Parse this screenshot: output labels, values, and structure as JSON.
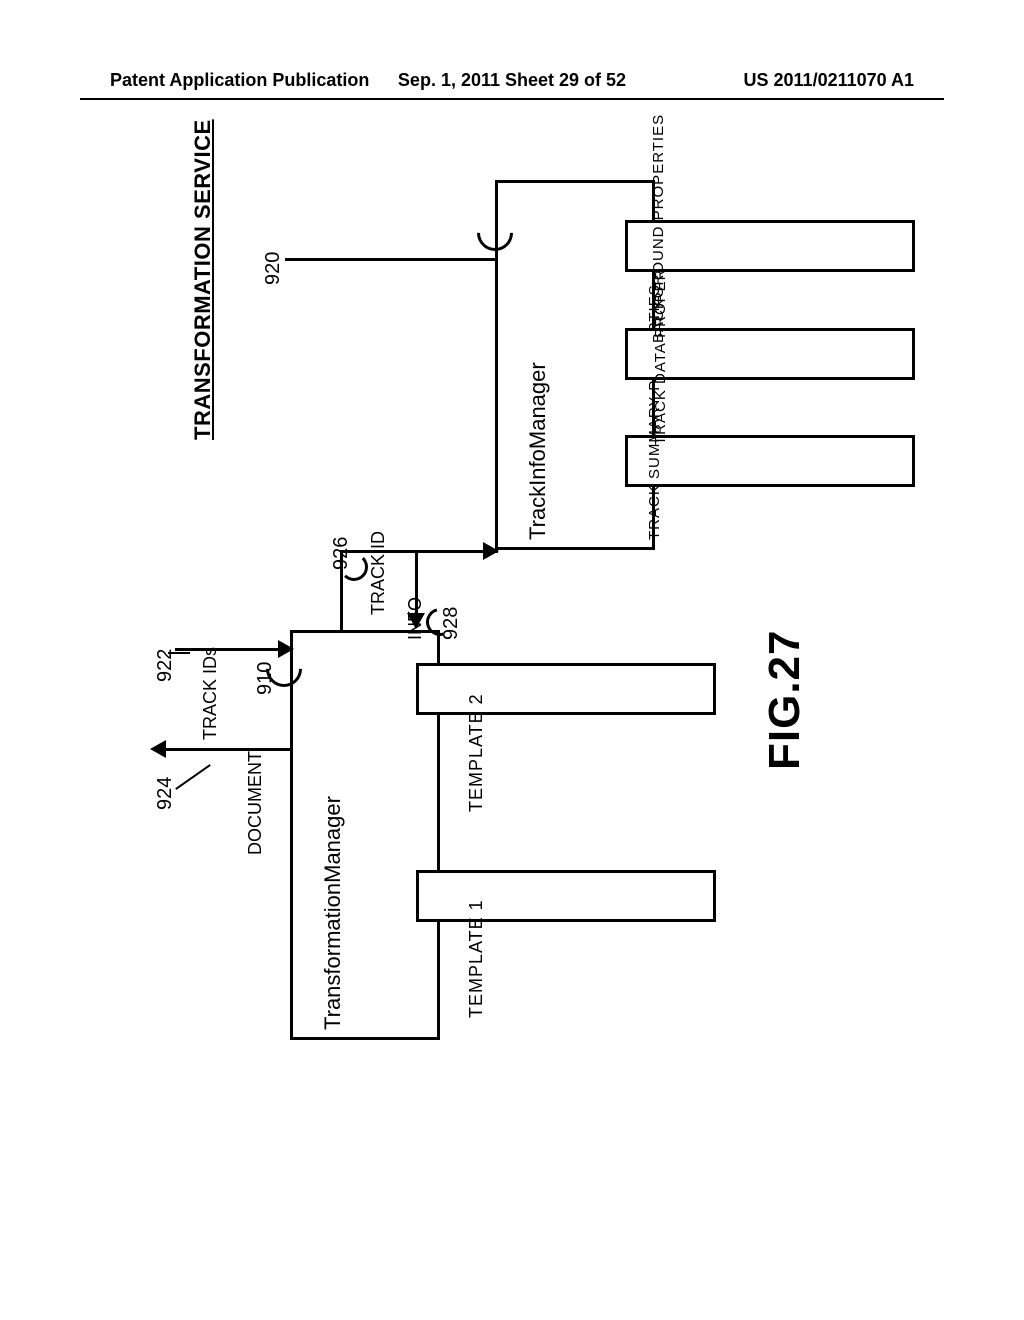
{
  "header": {
    "left": "Patent Application Publication",
    "center": "Sep. 1, 2011  Sheet 29 of 52",
    "right": "US 2011/0211070 A1"
  },
  "figure_label": "FIG.27",
  "service_title": "TRANSFORMATION SERVICE",
  "transformation_manager": {
    "title": "TransformationManager",
    "ref": "910",
    "templates": [
      "TEMPLATE 1",
      "TEMPLATE 2"
    ]
  },
  "track_info_manager": {
    "title": "TrackInfoManager",
    "ref": "920",
    "properties": [
      "TRACK SUMMARY PROPERTIES",
      "TRACK DATA PROPERTIES",
      "BACKGROUND PROPERTIES"
    ]
  },
  "arrows": {
    "track_ids_in": {
      "label": "TRACK IDs",
      "ref": "922"
    },
    "document_out": {
      "label": "DOCUMENT",
      "ref": "924"
    },
    "track_id_mid": {
      "label": "TRACK ID",
      "ref": "926"
    },
    "info_mid": {
      "label": "INFO",
      "ref": "928"
    }
  }
}
